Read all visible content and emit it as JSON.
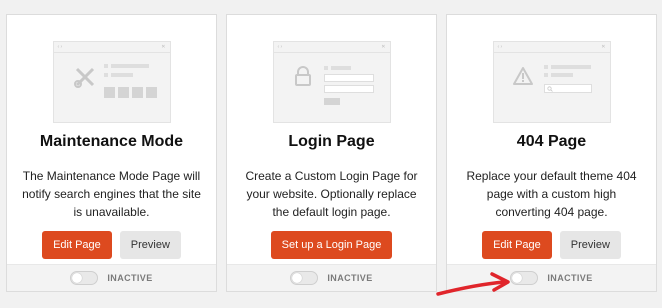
{
  "cards": [
    {
      "title": "Maintenance Mode",
      "description": "The Maintenance Mode Page will notify search engines that the site is unavailable.",
      "primary_button": "Edit Page",
      "secondary_button": "Preview",
      "status": "INACTIVE",
      "icon": "wrench-screwdriver-icon"
    },
    {
      "title": "Login Page",
      "description": "Create a Custom Login Page for your website. Optionally replace the default login page.",
      "primary_button": "Set up a Login Page",
      "status": "INACTIVE",
      "icon": "lock-icon"
    },
    {
      "title": "404 Page",
      "description": "Replace your default theme 404 page with a custom high converting 404 page.",
      "primary_button": "Edit Page",
      "secondary_button": "Preview",
      "status": "INACTIVE",
      "icon": "warning-icon"
    }
  ],
  "colors": {
    "primary": "#dd4a1f",
    "annotation_arrow": "#e0252b"
  }
}
